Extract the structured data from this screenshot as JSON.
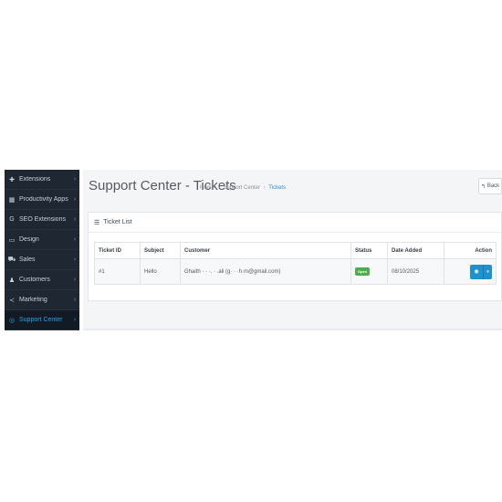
{
  "sidebar": {
    "items": [
      {
        "icon": "puzzle-icon",
        "glyph": "✚",
        "label": "Extensions"
      },
      {
        "icon": "grid-icon",
        "glyph": "▦",
        "label": "Productivity Apps"
      },
      {
        "icon": "google-icon",
        "glyph": "G",
        "label": "SEO Extensions"
      },
      {
        "icon": "monitor-icon",
        "glyph": "▭",
        "label": "Design"
      },
      {
        "icon": "cart-icon",
        "glyph": "⛟",
        "label": "Sales"
      },
      {
        "icon": "user-icon",
        "glyph": "♟",
        "label": "Customers"
      },
      {
        "icon": "share-icon",
        "glyph": "≺",
        "label": "Marketing"
      },
      {
        "icon": "lifebuoy-icon",
        "glyph": "◎",
        "label": "Support Center"
      }
    ],
    "chevron": "›"
  },
  "header": {
    "title": "Support Center - Tickets",
    "breadcrumb": [
      "Home",
      "Support Center",
      "Tickets"
    ],
    "breadcrumb_sep": "›",
    "back_label": "Back",
    "back_glyph": "↰"
  },
  "panel": {
    "heading": "Ticket List",
    "heading_glyph": "☰"
  },
  "table": {
    "columns": [
      "Ticket ID",
      "Subject",
      "Customer",
      "Status",
      "Date Added",
      "Action"
    ],
    "rows": [
      {
        "id": "#1",
        "subject": "Hello",
        "customer": "Ghaith ·  ·  ·.  ·  .ali (g·  · ·h·m@gmail.com)",
        "status": "Open",
        "date": "08/10/2025"
      }
    ],
    "view_glyph": "◉",
    "caret_glyph": "▾"
  },
  "colors": {
    "accent": "#1e91cf",
    "status_open": "#4cae4c",
    "sidebar_bg": "#1e2732",
    "active_link": "#2aa1e6"
  }
}
